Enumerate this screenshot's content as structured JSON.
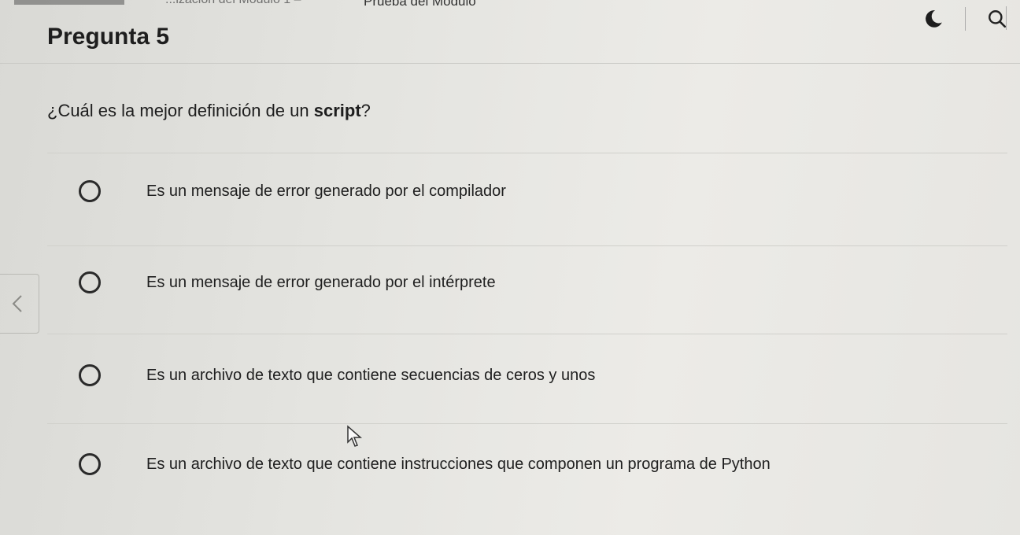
{
  "header": {
    "title_partial": "Prueba del Módulo",
    "left_partial": "...ización del Módulo 1 –"
  },
  "question": {
    "heading": "Pregunta 5",
    "text_before": "¿Cuál es la mejor definición de un ",
    "text_bold": "script",
    "text_after": "?"
  },
  "options": [
    {
      "label": "Es un mensaje de error generado por el compilador"
    },
    {
      "label": "Es un mensaje de error generado por el intérprete"
    },
    {
      "label": "Es un archivo de texto que contiene secuencias de ceros y unos"
    },
    {
      "label": "Es un archivo de texto que contiene instrucciones que componen un programa de Python"
    }
  ],
  "icons": {
    "theme": "moon-icon",
    "search": "search-icon",
    "prev": "chevron-left-icon",
    "cursor": "mouse-pointer-icon"
  },
  "colors": {
    "text": "#1e1e1e",
    "radio_border": "#2a2a2a"
  }
}
